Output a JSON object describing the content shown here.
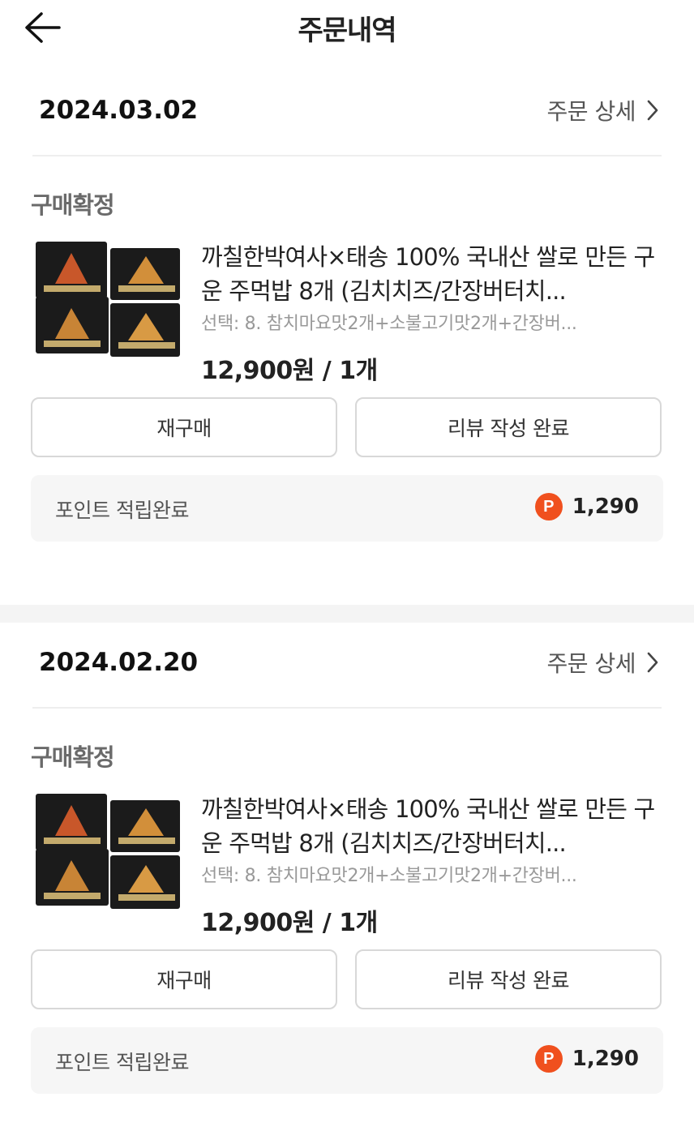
{
  "header": {
    "title": "주문내역"
  },
  "orders": [
    {
      "date": "2024.03.02",
      "detail_label": "주문 상세",
      "status": "구매확정",
      "product_name": "까칠한박여사×태송 100% 국내산 쌀로 만든 구운 주먹밥 8개 (김치치즈/간장버터치...",
      "option": "선택: 8. 참치마요맛2개+소불고기맛2개+간장버...",
      "price": "12,900원 / 1개",
      "rebuy_label": "재구매",
      "review_label": "리뷰 작성 완료",
      "point_label": "포인트 적립완료",
      "point_badge": "P",
      "point_value": "1,290"
    },
    {
      "date": "2024.02.20",
      "detail_label": "주문 상세",
      "status": "구매확정",
      "product_name": "까칠한박여사×태송 100% 국내산 쌀로 만든 구운 주먹밥 8개 (김치치즈/간장버터치...",
      "option": "선택: 8. 참치마요맛2개+소불고기맛2개+간장버...",
      "price": "12,900원 / 1개",
      "rebuy_label": "재구매",
      "review_label": "리뷰 작성 완료",
      "point_label": "포인트 적립완료",
      "point_badge": "P",
      "point_value": "1,290"
    }
  ],
  "colors": {
    "point_badge": "#f0501e",
    "divider": "#eeeeee",
    "point_bar_bg": "#f6f6f6"
  },
  "icons": {
    "back": "arrow-left-icon",
    "detail": "chevron-right-icon",
    "point": "point-badge-icon"
  }
}
